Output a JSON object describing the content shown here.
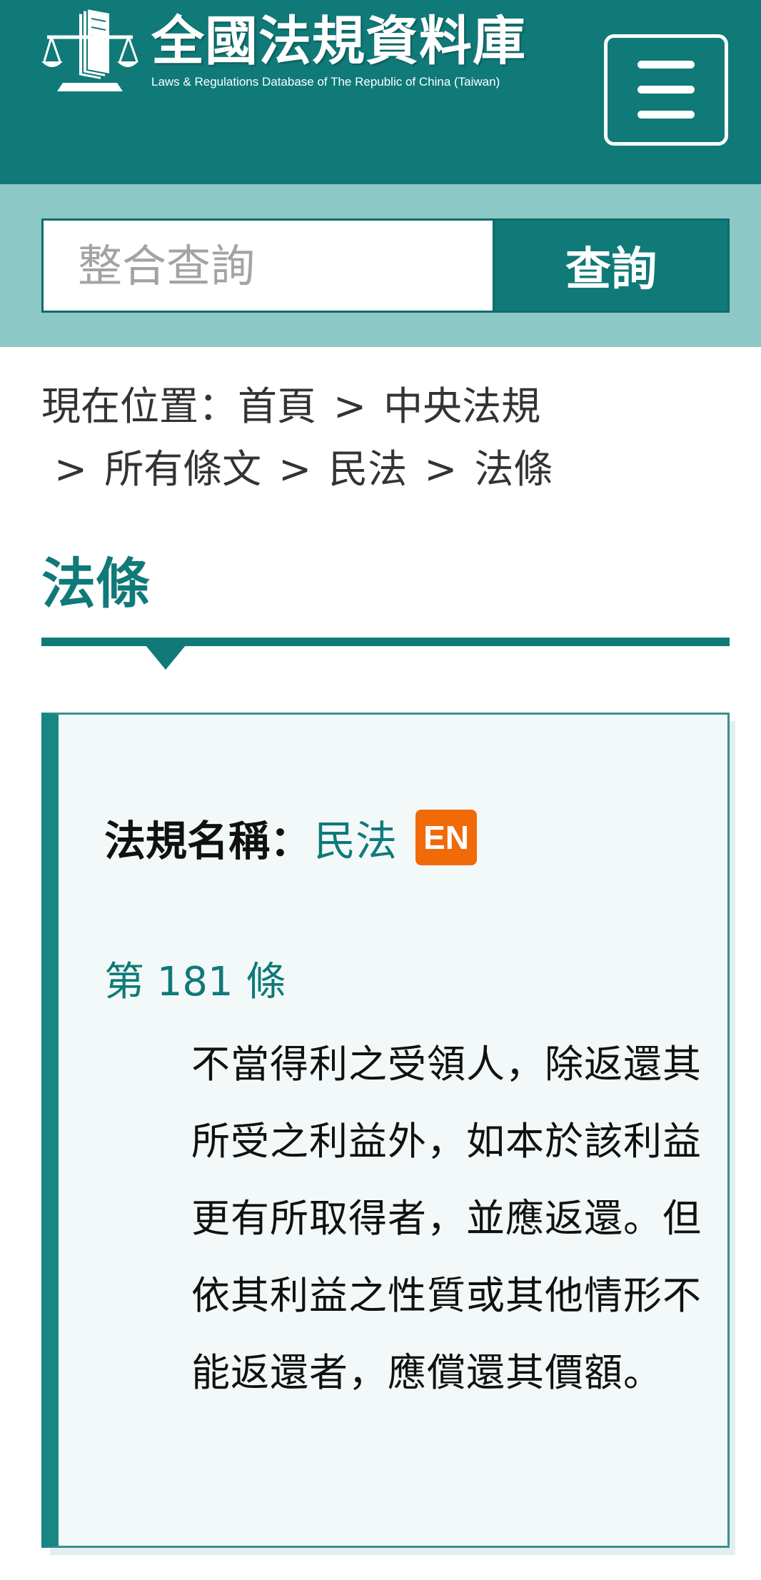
{
  "header": {
    "title": "全國法規資料庫",
    "subtitle": "Laws & Regulations Database of The Republic of China (Taiwan)",
    "logo_icon": "scales-book-icon",
    "menu_icon": "hamburger-menu-icon"
  },
  "search": {
    "placeholder": "整合查詢",
    "value": "",
    "button_label": "查詢"
  },
  "breadcrumb": {
    "label": "現在位置：",
    "separator": ">",
    "items": [
      "首頁",
      "中央法規",
      "所有條文",
      "民法",
      "法條"
    ]
  },
  "page": {
    "title": "法條"
  },
  "law": {
    "name_label": "法規名稱：",
    "name": "民法",
    "en_badge": "EN",
    "article_number": "第 181 條",
    "article_text": "不當得利之受領人，除返還其所受之利益外，如本於該利益更有所取得者，並應返還。但依其利益之性質或其他情形不能返還者，應償還其價額。"
  },
  "colors": {
    "brand_teal": "#0f7a78",
    "search_band": "#8cc8c5",
    "card_background": "#f3f9f9",
    "en_badge": "#f06a08"
  }
}
